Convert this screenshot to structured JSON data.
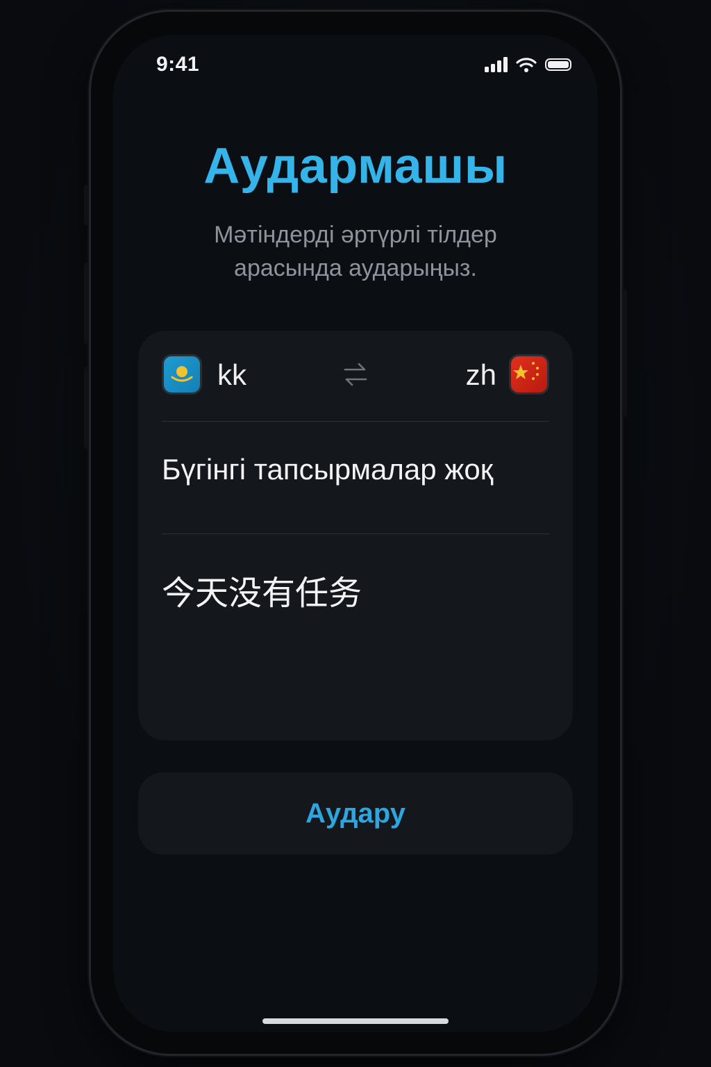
{
  "status_bar": {
    "time": "9:41",
    "icons": [
      "cellular-signal-icon",
      "wifi-icon",
      "battery-icon"
    ]
  },
  "header": {
    "title": "Аудармашы",
    "subtitle": "Мәтіндерді әртүрлі тілдер арасында аударыңыз."
  },
  "languages": {
    "source_code": "kk",
    "source_flag": "kazakhstan-flag-icon",
    "target_code": "zh",
    "target_flag": "china-flag-icon",
    "swap_icon": "swap-arrows-icon"
  },
  "translation": {
    "source_text": "Бүгінгі тапсырмалар жоқ",
    "result_text": "今天没有任务"
  },
  "actions": {
    "translate_label": "Аудару"
  },
  "colors": {
    "accent": "#35b4ea",
    "button_text": "#2ea5df",
    "background": "#0b0e12",
    "card": "#14171c",
    "subtitle": "#8e939c"
  }
}
